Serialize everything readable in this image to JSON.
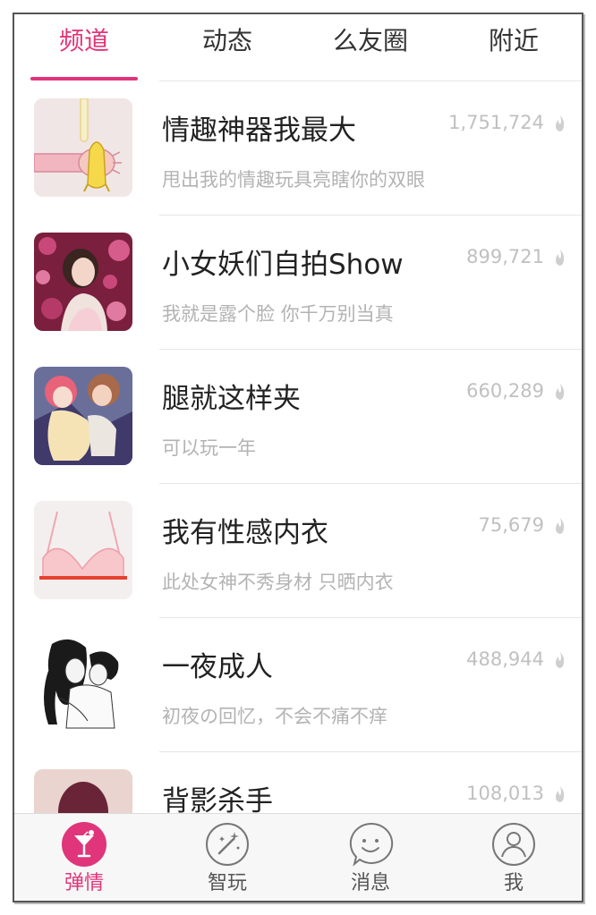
{
  "tabs": [
    {
      "label": "频道",
      "active": true
    },
    {
      "label": "动态",
      "active": false
    },
    {
      "label": "么友圈",
      "active": false
    },
    {
      "label": "附近",
      "active": false
    }
  ],
  "channels": [
    {
      "title": "情趣神器我最大",
      "subtitle": "甩出我的情趣玩具亮瞎你的双眼",
      "count": "1,751,724",
      "thumb_icon": "banana-hand-icon"
    },
    {
      "title": "小女妖们自拍Show",
      "subtitle": "我就是露个脸 你千万别当真",
      "count": "899,721",
      "thumb_icon": "woman-portrait-icon"
    },
    {
      "title": "腿就这样夹",
      "subtitle": "可以玩一年",
      "count": "660,289",
      "thumb_icon": "anime-couple-icon"
    },
    {
      "title": "我有性感内衣",
      "subtitle": "此处女神不秀身材 只晒内衣",
      "count": "75,679",
      "thumb_icon": "lingerie-icon"
    },
    {
      "title": "一夜成人",
      "subtitle": "初夜の回忆，不会不痛不痒",
      "count": "488,944",
      "thumb_icon": "sketch-couple-icon"
    },
    {
      "title": "背影杀手",
      "subtitle": "",
      "count": "108,013",
      "thumb_icon": "back-view-icon"
    }
  ],
  "bottom_nav": [
    {
      "label": "弹情",
      "icon": "cocktail-icon",
      "active": true
    },
    {
      "label": "智玩",
      "icon": "magic-wand-icon",
      "active": false
    },
    {
      "label": "消息",
      "icon": "smiley-chat-icon",
      "active": false
    },
    {
      "label": "我",
      "icon": "user-profile-icon",
      "active": false
    }
  ],
  "colors": {
    "accent": "#e0357a",
    "muted_text": "#b3b3b3",
    "count_text": "#c0c0c0"
  }
}
